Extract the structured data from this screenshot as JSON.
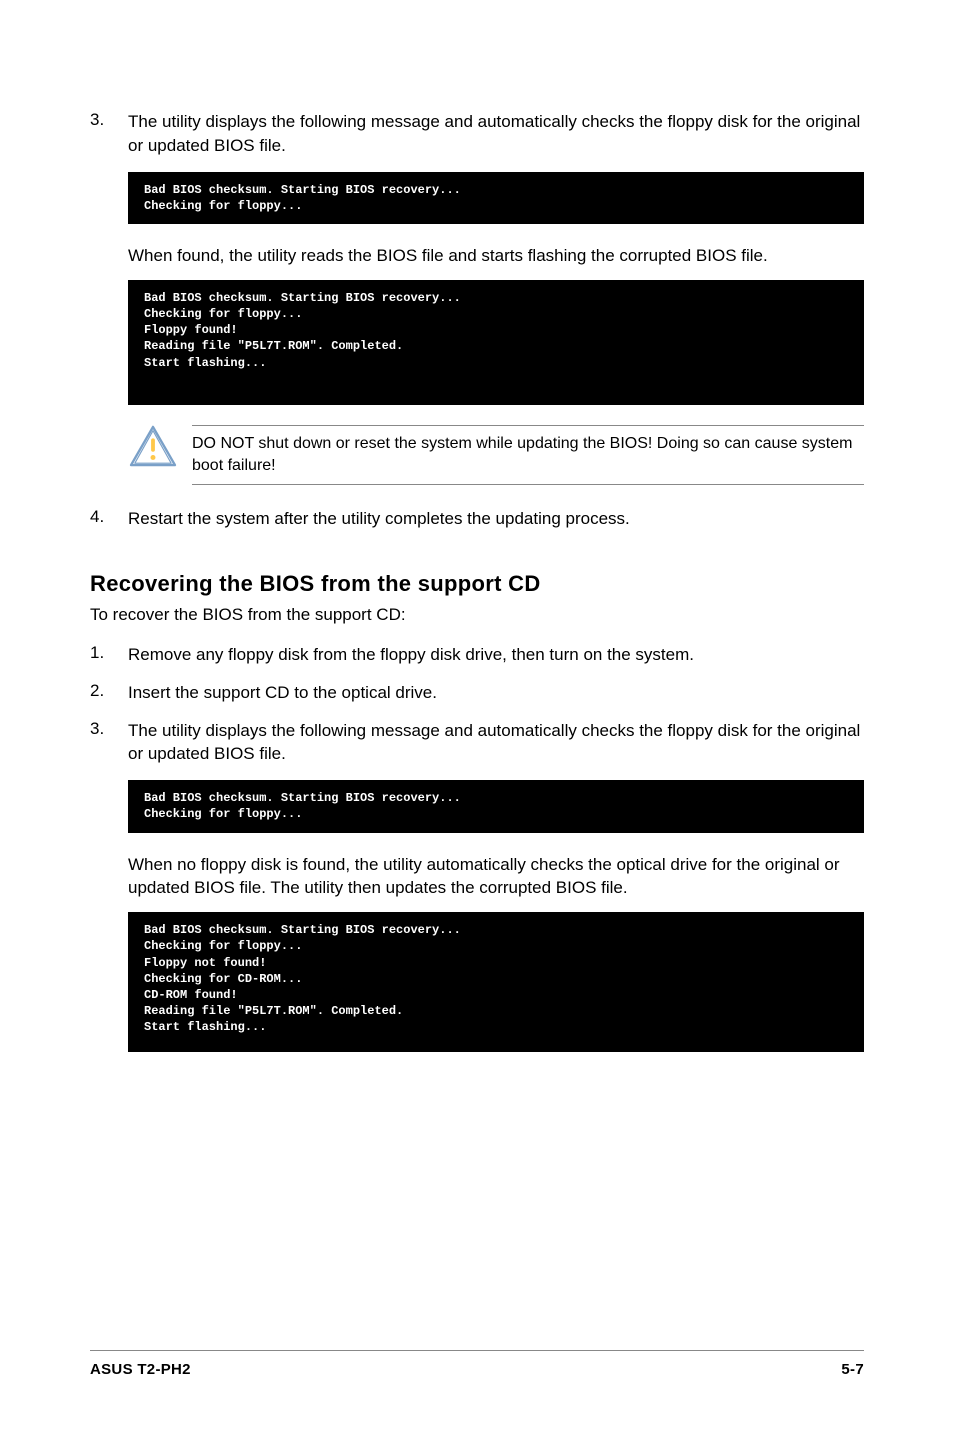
{
  "section1": {
    "item3_num": "3.",
    "item3_text": "The utility displays the following message and automatically checks the floppy disk for the original or updated BIOS file.",
    "code1": "Bad BIOS checksum. Starting BIOS recovery...\nChecking for floppy...",
    "after1": "When found, the utility reads the BIOS file and starts flashing the corrupted BIOS file.",
    "code2": "Bad BIOS checksum. Starting BIOS recovery...\nChecking for floppy...\nFloppy found!\nReading file \"P5L7T.ROM\". Completed.\nStart flashing...",
    "warn": "DO NOT shut down or reset the system while updating the BIOS! Doing so can cause system boot failure!",
    "item4_num": "4.",
    "item4_text": "Restart the system after the utility completes the updating process."
  },
  "section2": {
    "heading": "Recovering the BIOS from the support CD",
    "intro": "To recover the BIOS from the support CD:",
    "item1_num": "1.",
    "item1_text": "Remove any floppy disk from the floppy disk drive, then turn on the system.",
    "item2_num": "2.",
    "item2_text": "Insert the support CD to the optical drive.",
    "item3_num": "3.",
    "item3_text": "The utility displays the following message and automatically checks the floppy disk for the original or updated BIOS file.",
    "code1": "Bad BIOS checksum. Starting BIOS recovery...\nChecking for floppy...",
    "after1": "When no floppy disk is found, the utility automatically checks the optical drive for the original or updated BIOS file. The utility then updates the corrupted BIOS file.",
    "code2": "Bad BIOS checksum. Starting BIOS recovery...\nChecking for floppy...\nFloppy not found!\nChecking for CD-ROM...\nCD-ROM found!\nReading file \"P5L7T.ROM\". Completed.\nStart flashing..."
  },
  "footer": {
    "left": "ASUS T2-PH2",
    "right": "5-7"
  }
}
